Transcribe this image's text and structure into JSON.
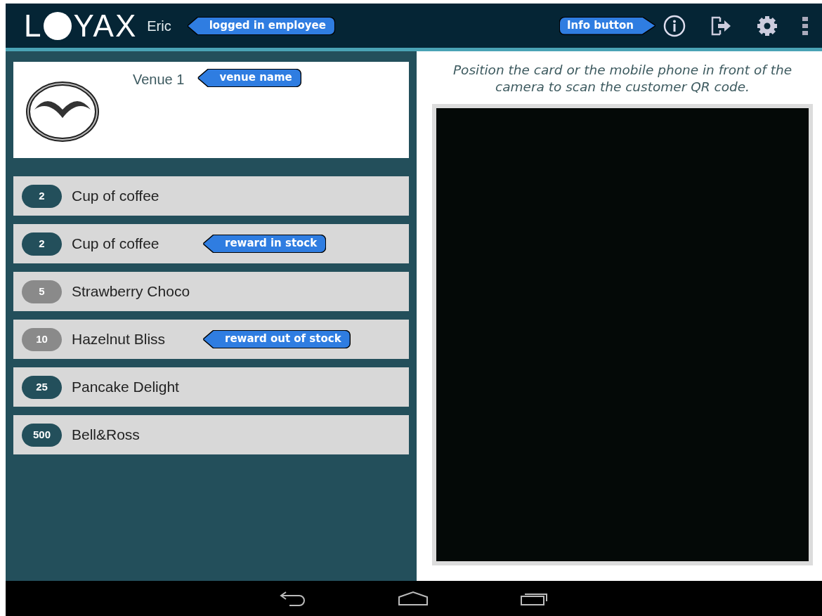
{
  "header": {
    "logo_text": [
      "L",
      "YAX"
    ],
    "employee": "Eric",
    "annotations": [
      {
        "text": "logged in employee",
        "kind": "left"
      },
      {
        "text": "Info button",
        "kind": "right"
      }
    ]
  },
  "venue": {
    "name": "Venue 1",
    "annotation": "venue name"
  },
  "rewards": [
    {
      "points": "2",
      "name": "Cup of coffee",
      "in_stock": true
    },
    {
      "points": "2",
      "name": "Cup of coffee",
      "in_stock": true,
      "annotation": "reward in stock"
    },
    {
      "points": "5",
      "name": "Strawberry Choco",
      "in_stock": false
    },
    {
      "points": "10",
      "name": "Hazelnut Bliss",
      "in_stock": false,
      "annotation": "reward out of stock"
    },
    {
      "points": "25",
      "name": "Pancake Delight",
      "in_stock": true
    },
    {
      "points": "500",
      "name": "Bell&Ross",
      "in_stock": true
    }
  ],
  "scanner": {
    "instruction": "Position the card or the mobile phone in front of the camera to scan the customer QR code."
  }
}
